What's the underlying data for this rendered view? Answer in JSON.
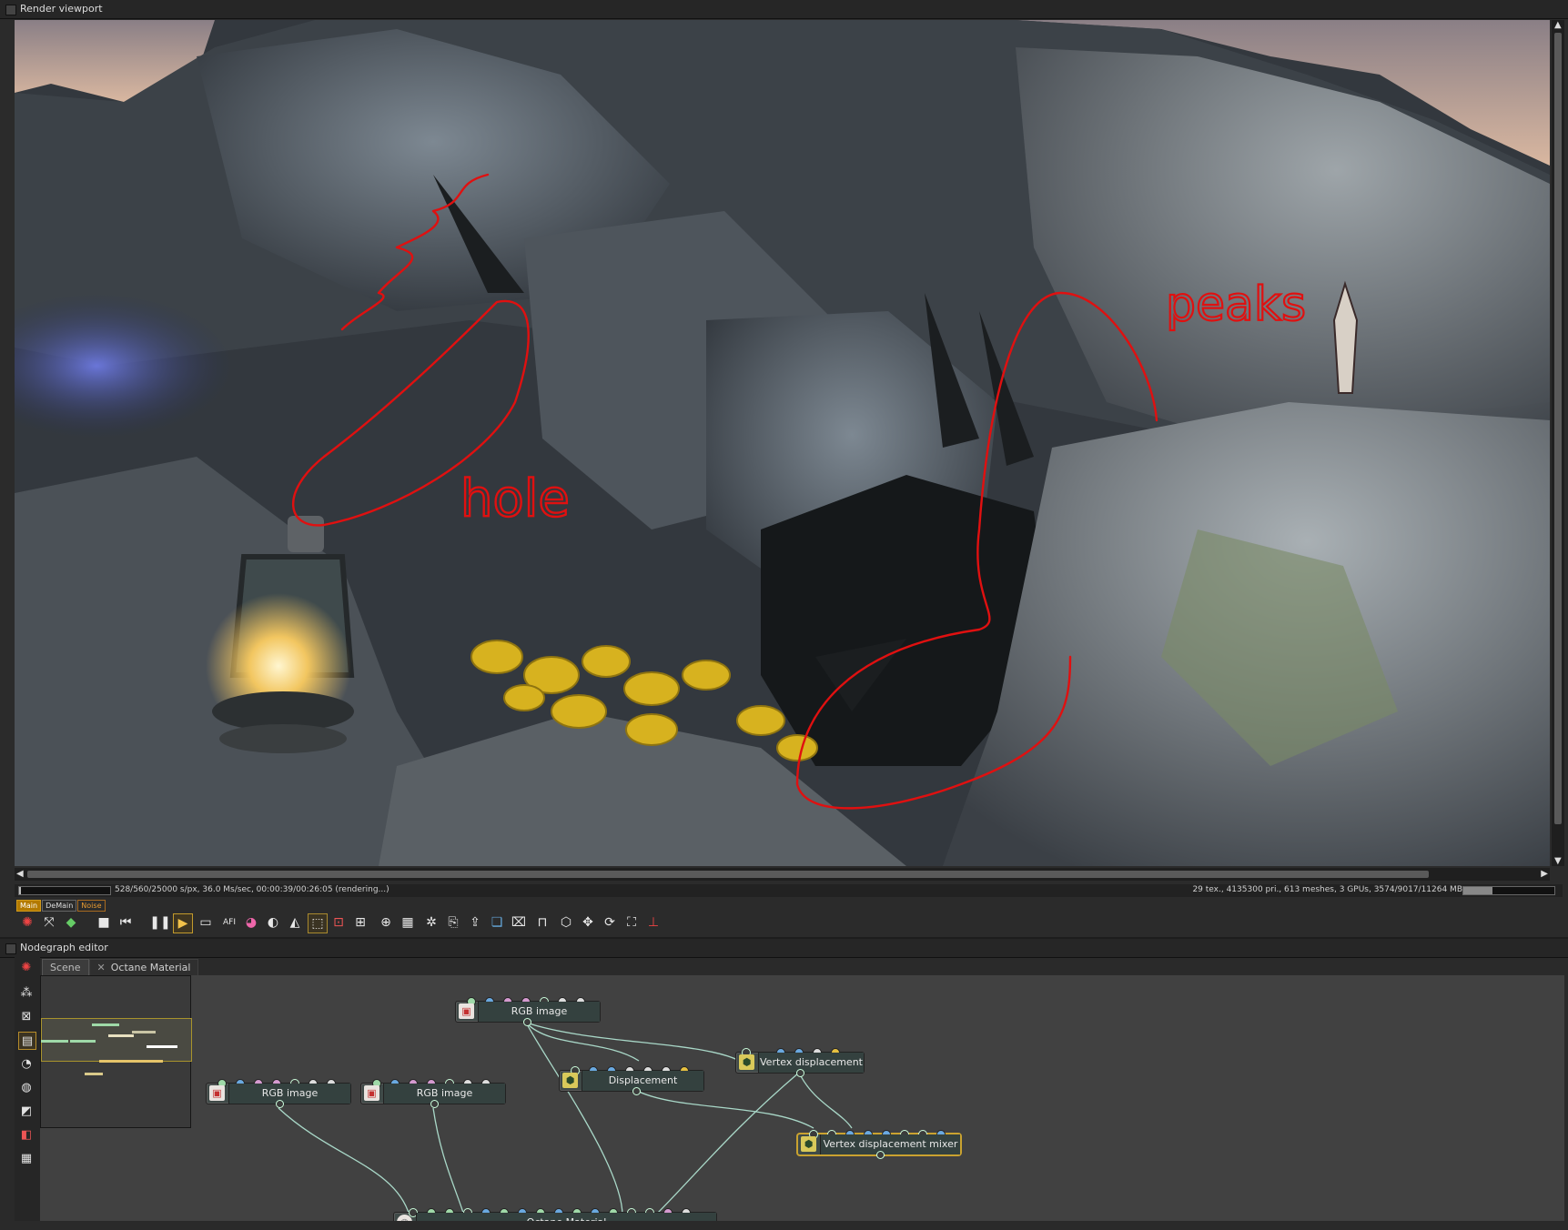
{
  "render_viewport": {
    "title": "Render viewport",
    "annotations": {
      "hole": "hole",
      "peaks": "peaks"
    },
    "status_left": "528/560/25000 s/px, 36.0 Ms/sec, 00:00:39/00:26:05 (rendering...)",
    "status_right": "29 tex., 4135300 pri., 613 meshes, 3 GPUs, 3574/9017/11264 MB",
    "render_progress": 0.02,
    "gpu_memory_used_fraction": 0.32,
    "pass_tabs": [
      "Main",
      "DeMain",
      "Noise"
    ],
    "active_pass": "Main",
    "colors": {
      "annotation": "#e01010",
      "accent": "#c9a230"
    }
  },
  "toolbar": {
    "icons": [
      "octane-logo-icon",
      "recenter-icon",
      "cube-color-icon",
      "stop-icon",
      "restart-icon",
      "pause-icon",
      "play-icon",
      "display-icon",
      "afi-icon",
      "color-wheel-icon",
      "clay-icon",
      "exposure-icon",
      "region-icon",
      "film-region-icon",
      "cropped-icon",
      "zoom-icon",
      "picker-icon",
      "lock-icon",
      "clipboard-icon",
      "save-icon",
      "layers-icon",
      "camera-icon",
      "unlock-icon",
      "box-icon",
      "move-icon",
      "rotate-icon",
      "scale-icon",
      "axis-icon"
    ]
  },
  "nodegraph": {
    "title": "Nodegraph editor",
    "tabs": [
      "Scene",
      "Octane Material"
    ],
    "nodes": {
      "rgb_top": "RGB image",
      "rgb_left": "RGB image",
      "rgb_mid": "RGB image",
      "displacement": "Displacement",
      "vertex_displacement": "Vertex displacement",
      "vertex_displacement_mixer": "Vertex displacement mixer",
      "octane_material": "Octane Material"
    },
    "colors": {
      "node_body": "#34413f",
      "wire": "#a9d8c8",
      "selected": "#c9a230"
    }
  }
}
